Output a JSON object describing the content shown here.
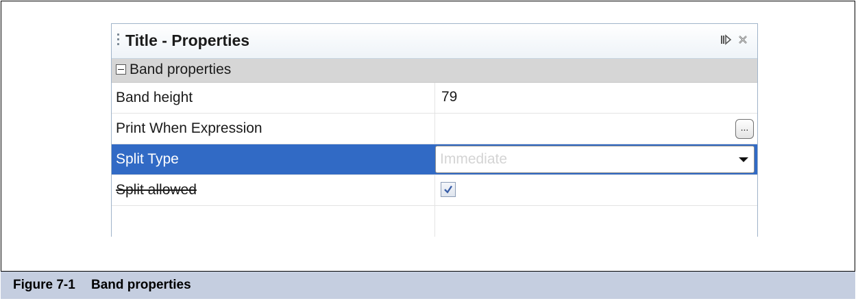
{
  "panel": {
    "title": "Title - Properties",
    "icons": [
      "dock-icon",
      "close-icon"
    ]
  },
  "section": {
    "label": "Band properties",
    "expanded": true
  },
  "properties": [
    {
      "name": "Band height",
      "value": "79"
    },
    {
      "name": "Print When Expression",
      "value": "",
      "button_label": "..."
    },
    {
      "name": "Split Type",
      "value": "Immediate",
      "selected": true
    },
    {
      "name": "Split allowed",
      "checked": true,
      "deprecated": true
    }
  ],
  "caption": {
    "number": "Figure 7-1",
    "text": "Band properties"
  },
  "colors": {
    "selection": "#316ac5",
    "section_bg": "#d6d6d6",
    "caption_bg": "#c5cee0"
  }
}
